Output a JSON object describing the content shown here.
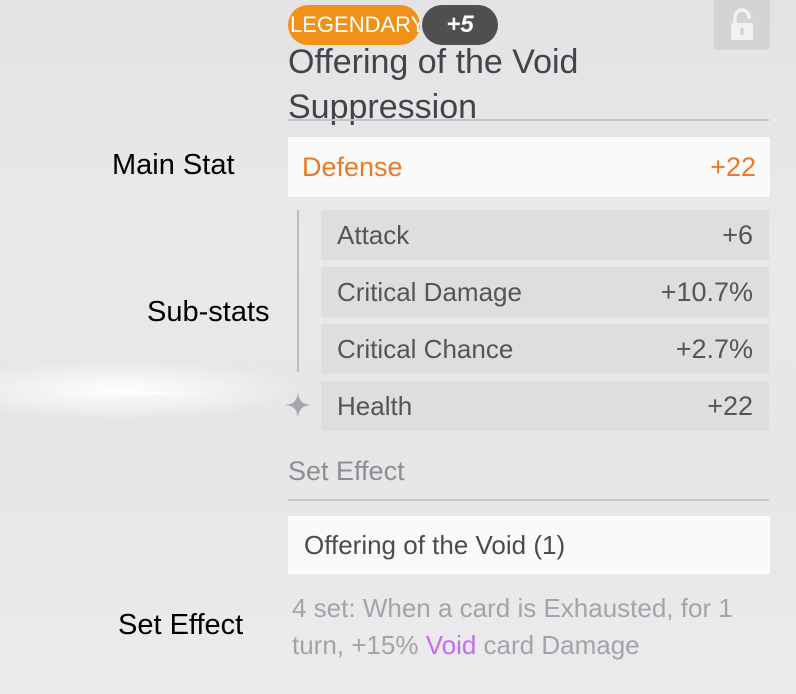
{
  "item": {
    "rarity": "LEGENDARY",
    "level": "+5",
    "name": "Offering of the Void Suppression"
  },
  "annotations": {
    "main_stat": "Main Stat",
    "sub_stats": "Sub-stats",
    "set_effect": "Set Effect"
  },
  "main_stat": {
    "name": "Defense",
    "value": "+22"
  },
  "sub_stats": [
    {
      "name": "Attack",
      "value": "+6"
    },
    {
      "name": "Critical Damage",
      "value": "+10.7%"
    },
    {
      "name": "Critical Chance",
      "value": "+2.7%"
    },
    {
      "name": "Health",
      "value": "+22"
    }
  ],
  "set_effect": {
    "heading": "Set Effect",
    "set_name": "Offering of the Void (1)",
    "desc_prefix": "4 set: When a card is Exhausted, for 1 turn, +15% ",
    "desc_highlight": "Void",
    "desc_suffix": " card Damage"
  },
  "icons": {
    "lock": "lock-open-icon",
    "sparkle": "sparkle-icon"
  },
  "colors": {
    "rarity": "#f0921a",
    "main_stat": "#ec7a22",
    "void": "#c56cf0"
  }
}
